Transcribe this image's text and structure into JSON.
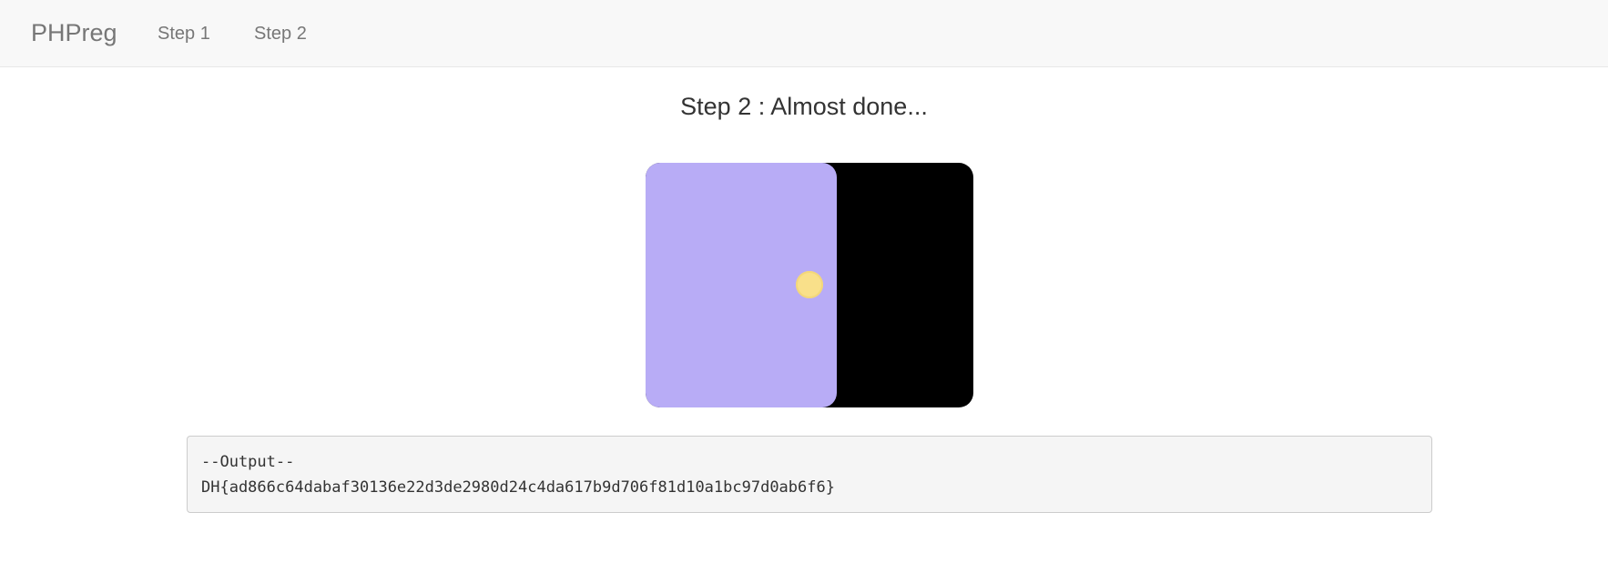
{
  "navbar": {
    "brand": "PHPreg",
    "links": [
      {
        "label": "Step 1"
      },
      {
        "label": "Step 2"
      }
    ]
  },
  "main": {
    "title": "Step 2 : Almost done...",
    "door": {
      "panel_color": "#b8acf6",
      "frame_color": "#000000",
      "knob_color": "#f9e08a"
    },
    "output": {
      "header": "--Output--",
      "flag": "DH{ad866c64dabaf30136e22d3de2980d24c4da617b9d706f81d10a1bc97d0ab6f6}"
    }
  }
}
